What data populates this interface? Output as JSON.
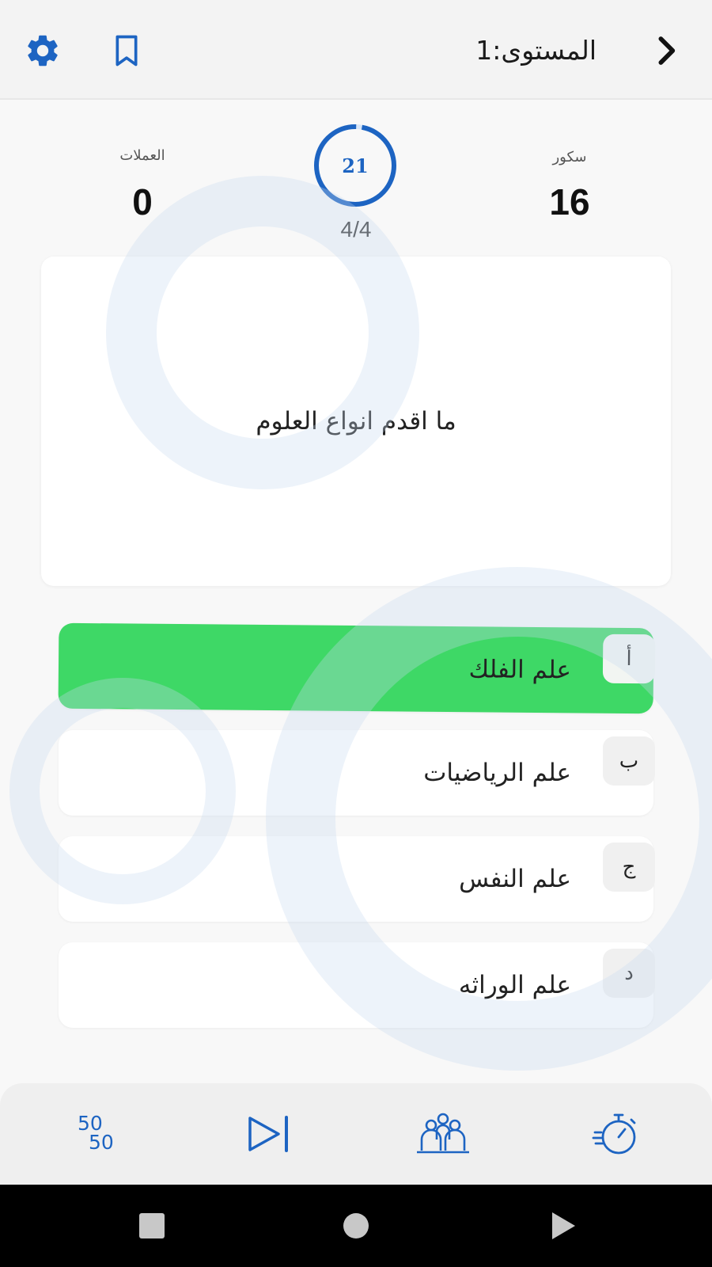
{
  "header": {
    "level_title": "المستوى:1",
    "icons": {
      "back": "chevron-right-icon",
      "bookmark": "bookmark-icon",
      "settings": "gear-icon"
    }
  },
  "stats": {
    "score_label": "سكور",
    "score_value": "16",
    "coins_label": "العملات",
    "coins_value": "0",
    "timer_value": "21",
    "progress_count": "4/4"
  },
  "question": {
    "text": "ما اقدم انواع العلوم"
  },
  "answers": [
    {
      "letter": "أ",
      "text": "علم الفلك",
      "state": "correct"
    },
    {
      "letter": "ب",
      "text": "علم الرياضيات",
      "state": "normal"
    },
    {
      "letter": "ج",
      "text": "علم النفس",
      "state": "normal"
    },
    {
      "letter": "د",
      "text": "علم الوراثه",
      "state": "normal"
    }
  ],
  "lifelines": {
    "fifty_fifty": {
      "top": "50",
      "bottom": "50",
      "icon": "fifty-fifty-icon"
    },
    "skip": {
      "icon": "skip-next-icon"
    },
    "audience": {
      "icon": "audience-icon"
    },
    "time": {
      "icon": "stopwatch-icon"
    }
  },
  "colors": {
    "accent": "#1d64c2",
    "correct": "#3ed866",
    "background": "#f8f8f8"
  },
  "system_nav": {
    "icons": [
      "recents-square-icon",
      "home-circle-icon",
      "back-triangle-icon"
    ]
  }
}
